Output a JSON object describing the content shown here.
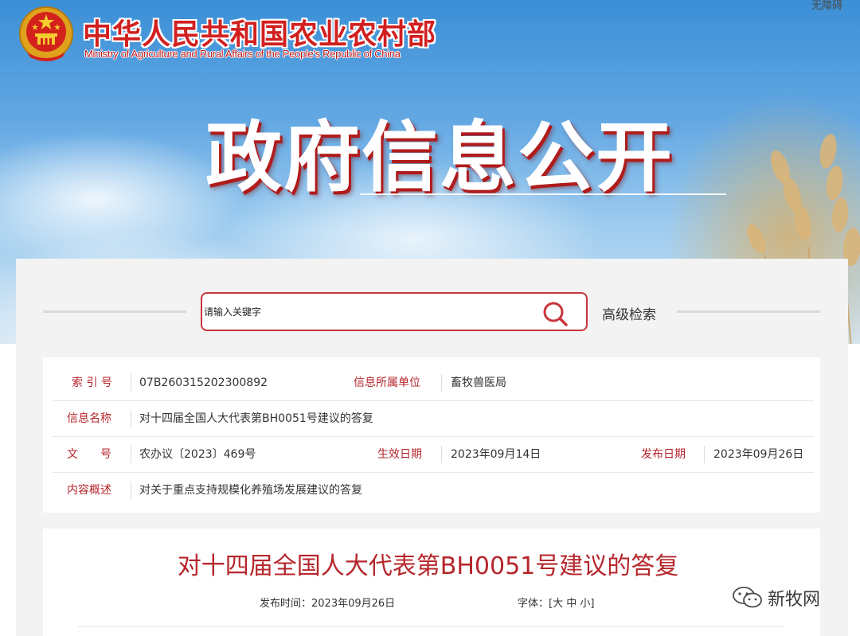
{
  "header": {
    "top_right_text": "无障碍",
    "ministry_cn": "中华人民共和国农业农村部",
    "ministry_en": "Ministry of Agriculture and Rural Affairs of the People's Republic of China",
    "section_title": "政府信息公开"
  },
  "search": {
    "placeholder": "请输入关键字",
    "button_icon": "search-icon",
    "advanced_label": "高级检索"
  },
  "info": {
    "index_label": "索 引 号",
    "index_value": "07B260315202300892",
    "dept_label": "信息所属单位",
    "dept_value": "畜牧兽医局",
    "name_label": "信息名称",
    "name_value": "对十四届全国人大代表第BH0051号建议的答复",
    "doc_label": "文　　号",
    "doc_value": "农办议〔2023〕469号",
    "effective_label": "生效日期",
    "effective_value": "2023年09月14日",
    "publish_label": "发布日期",
    "publish_value": "2023年09月26日",
    "summary_label": "内容概述",
    "summary_value": "对关于重点支持规模化养殖场发展建议的答复"
  },
  "article": {
    "title": "对十四届全国人大代表第BH0051号建议的答复",
    "pub_time_label": "发布时间：",
    "pub_time_value": "2023年09月26日",
    "font_label": "字体：",
    "font_open": "[",
    "font_large": "大",
    "font_medium": "中",
    "font_small": "小",
    "font_close": "]"
  },
  "watermark": {
    "icon": "wechat-icon",
    "text": "新牧网"
  },
  "colors": {
    "accent_red": "#b5262b",
    "search_border": "#c9353a",
    "ministry_red": "#d21f1f"
  }
}
